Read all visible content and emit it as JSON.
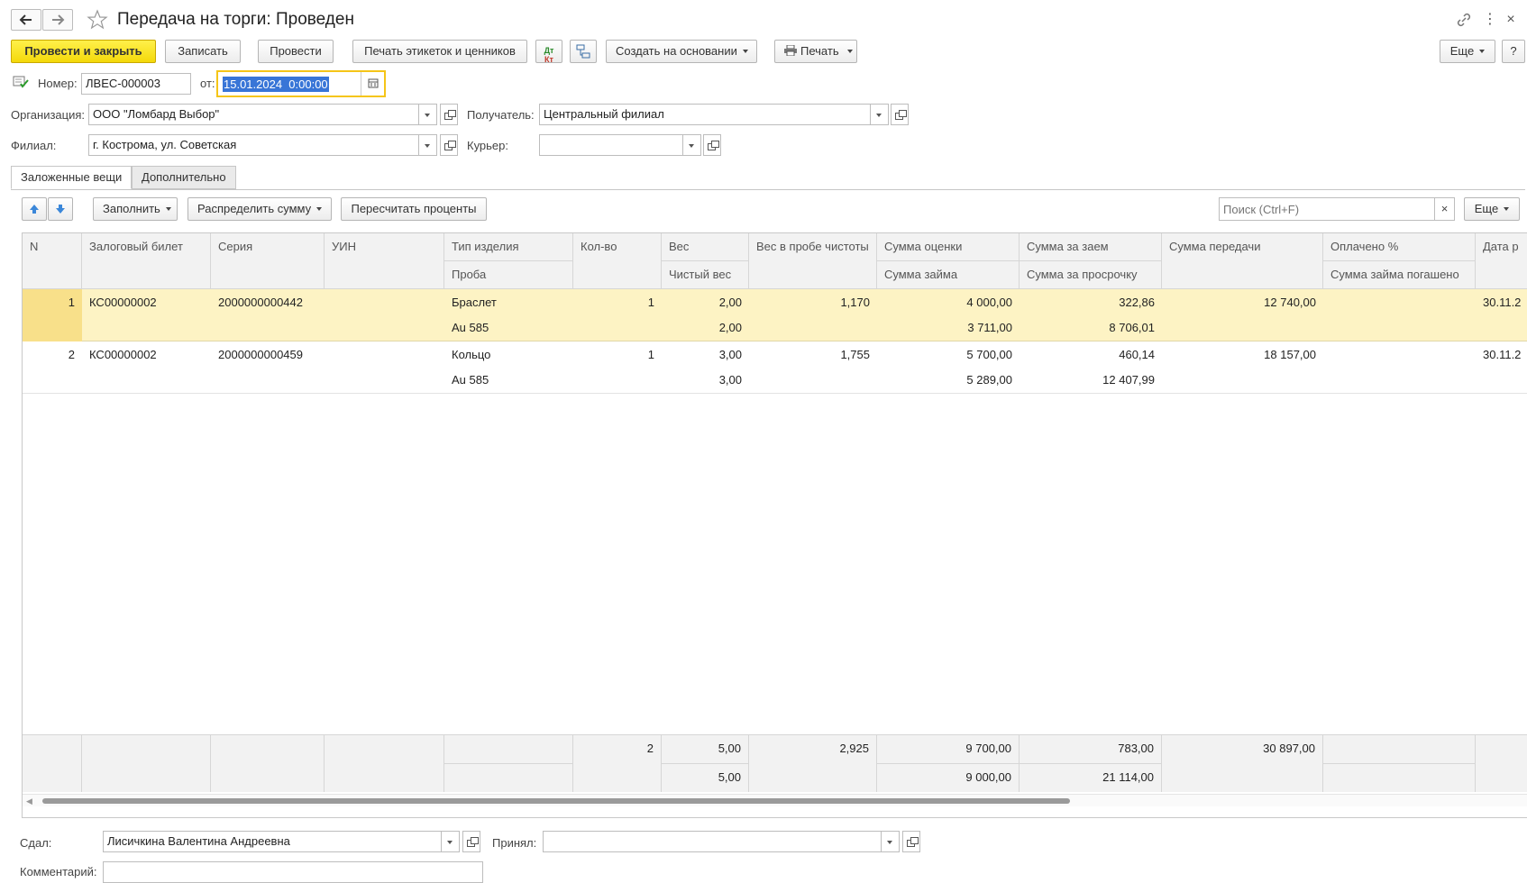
{
  "window": {
    "title": "Передача на торги: Проведен"
  },
  "toolbar": {
    "post_and_close": "Провести и закрыть",
    "save": "Записать",
    "post": "Провести",
    "print_labels": "Печать этикеток и ценников",
    "create_based_on": "Создать на основании",
    "print": "Печать",
    "more": "Еще",
    "help": "?"
  },
  "header": {
    "number_label": "Номер:",
    "number_value": "ЛВЕС-000003",
    "date_label": "от:",
    "date_value": "15.01.2024  0:00:00",
    "org_label": "Организация:",
    "org_value": "ООО \"Ломбард Выбор\"",
    "recipient_label": "Получатель:",
    "recipient_value": "Центральный филиал",
    "branch_label": "Филиал:",
    "branch_value": "г. Кострома, ул. Советская",
    "courier_label": "Курьер:",
    "courier_value": ""
  },
  "tabs": [
    {
      "label": "Заложенные вещи",
      "active": true
    },
    {
      "label": "Дополнительно",
      "active": false
    }
  ],
  "table_toolbar": {
    "fill": "Заполнить",
    "distribute": "Распределить сумму",
    "recalc": "Пересчитать проценты",
    "search_placeholder": "Поиск (Ctrl+F)",
    "clear": "×",
    "more": "Еще"
  },
  "table": {
    "headers_top": [
      "N",
      "Залоговый билет",
      "Серия",
      "УИН",
      "Тип изделия",
      "Кол-во",
      "Вес",
      "Вес в пробе чистоты",
      "Сумма оценки",
      "Сумма за заем",
      "Сумма передачи",
      "Оплачено %",
      "Дата р"
    ],
    "headers_bottom": [
      "Проба",
      "Чистый вес",
      "Сумма займа",
      "Сумма за просрочку",
      "Сумма займа погашено"
    ],
    "rows": [
      {
        "n": "1",
        "ticket": "КС00000002",
        "series": "2000000000442",
        "uin": "",
        "type": "Браслет",
        "probe": "Au 585",
        "qty": "1",
        "weight": "2,00",
        "net_weight": "2,00",
        "pure_weight": "1,170",
        "appraisal": "4 000,00",
        "loan": "3 711,00",
        "loan_fee": "322,86",
        "overdue": "8 706,01",
        "transfer": "12 740,00",
        "paid_pct": "",
        "loan_repaid": "",
        "date": "30.11.2"
      },
      {
        "n": "2",
        "ticket": "КС00000002",
        "series": "2000000000459",
        "uin": "",
        "type": "Кольцо",
        "probe": "Au 585",
        "qty": "1",
        "weight": "3,00",
        "net_weight": "3,00",
        "pure_weight": "1,755",
        "appraisal": "5 700,00",
        "loan": "5 289,00",
        "loan_fee": "460,14",
        "overdue": "12 407,99",
        "transfer": "18 157,00",
        "paid_pct": "",
        "loan_repaid": "",
        "date": "30.11.2"
      }
    ],
    "totals": {
      "qty": "2",
      "weight": "5,00",
      "net_weight": "5,00",
      "pure_weight": "2,925",
      "appraisal": "9 700,00",
      "loan": "9 000,00",
      "loan_fee": "783,00",
      "overdue": "21 114,00",
      "transfer": "30 897,00"
    }
  },
  "footer": {
    "handed_label": "Сдал:",
    "handed_value": "Лисичкина Валентина Андреевна",
    "accepted_label": "Принял:",
    "accepted_value": "",
    "comment_label": "Комментарий:",
    "comment_value": ""
  },
  "colors": {
    "accent_yellow": "#f4d90a",
    "selected_row": "#fdf3c4",
    "date_highlight": "#3875d7"
  },
  "icons": [
    "back-icon",
    "forward-icon",
    "star-icon",
    "link-icon",
    "more-vert-icon",
    "close-icon",
    "dt-kt-icon",
    "structure-icon",
    "printer-icon",
    "doc-status-icon",
    "calendar-icon",
    "arrow-up-icon",
    "arrow-down-icon"
  ]
}
